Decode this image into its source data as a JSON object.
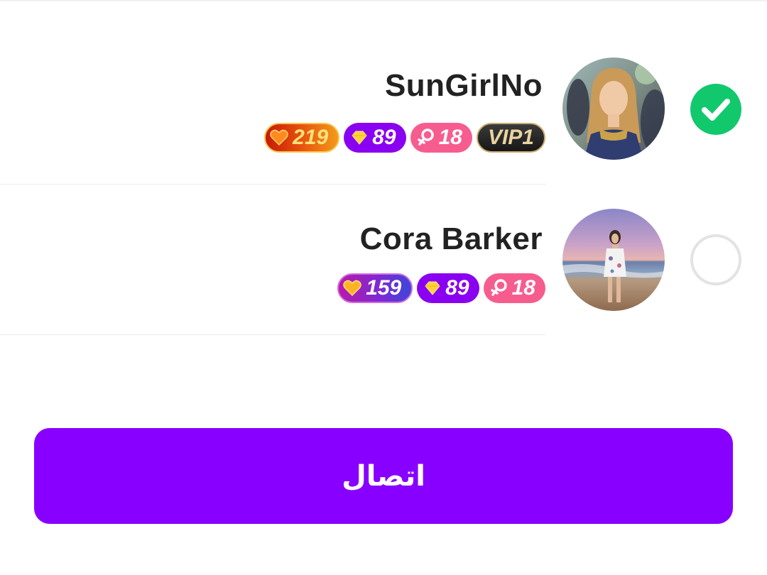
{
  "users": [
    {
      "name": "SunGirlNo",
      "selected": true,
      "badges": {
        "heat": "219",
        "diamonds": "89",
        "age": "18",
        "vip": "VIP1"
      }
    },
    {
      "name": "Cora Barker",
      "selected": false,
      "badges": {
        "heat": "159",
        "diamonds": "89",
        "age": "18"
      }
    }
  ],
  "connect_button": {
    "label": "اتصال"
  },
  "colors": {
    "accent": "#8800ff",
    "selected": "#12c86d",
    "female_badge": "#f75c8f",
    "diamond_badge": "#8a00f0"
  },
  "icons": {
    "selected": "check-icon",
    "heat": "heart-icon",
    "diamond": "diamond-icon",
    "gender": "female-icon"
  }
}
